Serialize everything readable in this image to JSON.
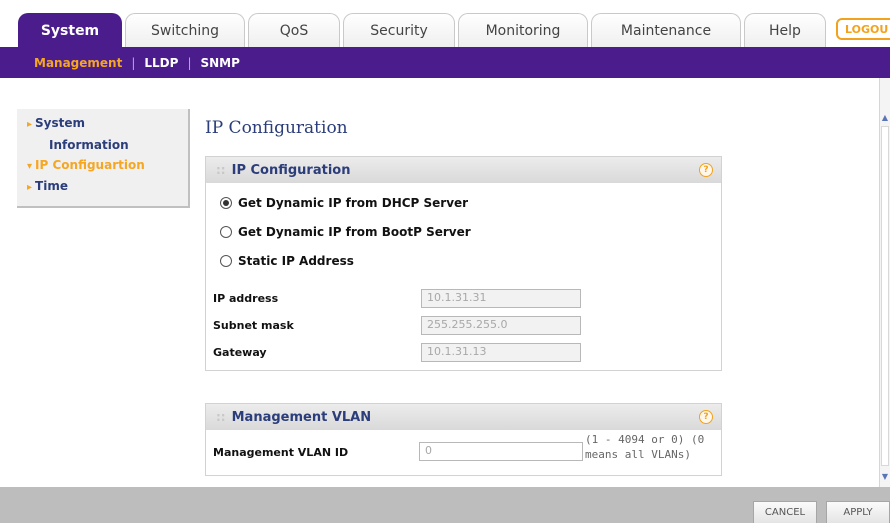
{
  "tabs": [
    {
      "label": "System",
      "active": true
    },
    {
      "label": "Switching",
      "active": false
    },
    {
      "label": "QoS",
      "active": false
    },
    {
      "label": "Security",
      "active": false
    },
    {
      "label": "Monitoring",
      "active": false
    },
    {
      "label": "Maintenance",
      "active": false
    },
    {
      "label": "Help",
      "active": false
    }
  ],
  "logout_label": "LOGOU",
  "subnav": [
    {
      "label": "Management",
      "active": true
    },
    {
      "label": "LLDP",
      "active": false
    },
    {
      "label": "SNMP",
      "active": false
    }
  ],
  "sidebar": {
    "items": [
      {
        "line1": "System",
        "line2": "Information"
      },
      {
        "line1": "IP Configuartion",
        "active": true
      },
      {
        "line1": "Time"
      }
    ]
  },
  "page_title": "IP Configuration",
  "ip_panel": {
    "title": "IP Configuration",
    "help_glyph": "?",
    "options": [
      {
        "label": "Get Dynamic IP from DHCP Server",
        "selected": true
      },
      {
        "label": "Get Dynamic IP from BootP Server",
        "selected": false
      },
      {
        "label": "Static IP Address",
        "selected": false
      }
    ],
    "fields": [
      {
        "label": "IP address",
        "value": "10.1.31.31"
      },
      {
        "label": "Subnet mask",
        "value": "255.255.255.0"
      },
      {
        "label": "Gateway",
        "value": "10.1.31.13"
      }
    ]
  },
  "vlan_panel": {
    "title": "Management VLAN",
    "help_glyph": "?",
    "field_label": "Management VLAN ID",
    "field_value": "0",
    "note_line1": "(1 - 4094 or 0) (0",
    "note_line2": "means all VLANs)"
  },
  "buttons": {
    "cancel": "CANCEL",
    "apply": "APPLY"
  },
  "icons": {
    "arrow_right": "arrow-right-icon",
    "arrow_down": "arrow-down-icon",
    "help": "help-icon",
    "grip": "grip-icon"
  },
  "colors": {
    "brand_purple": "#4b1c8c",
    "accent_orange": "#f5a623",
    "title_blue": "#2b3d7a"
  }
}
